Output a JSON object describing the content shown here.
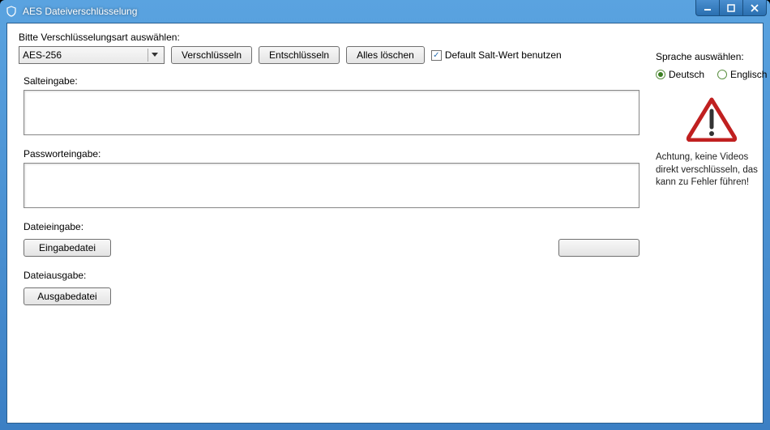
{
  "window": {
    "title": "AES Dateiverschlüsselung"
  },
  "toolbar": {
    "select_label": "Bitte Verschlüsselungsart auswählen:",
    "selected_algo": "AES-256",
    "encrypt": "Verschlüsseln",
    "decrypt": "Entschlüsseln",
    "clear_all": "Alles löschen",
    "default_salt": "Default Salt-Wert benutzen"
  },
  "fields": {
    "salt_label": "Salteingabe:",
    "salt_value": "",
    "password_label": "Passworteingabe:",
    "password_value": "",
    "file_in_label": "Dateieingabe:",
    "file_in_button": "Eingabedatei",
    "file_out_label": "Dateiausgabe:",
    "file_out_button": "Ausgabedatei"
  },
  "side": {
    "lang_label": "Sprache auswählen:",
    "lang_de": "Deutsch",
    "lang_en": "Englisch",
    "warning": "Achtung, keine Videos direkt verschlüsseln, das kann zu Fehler führen!"
  }
}
